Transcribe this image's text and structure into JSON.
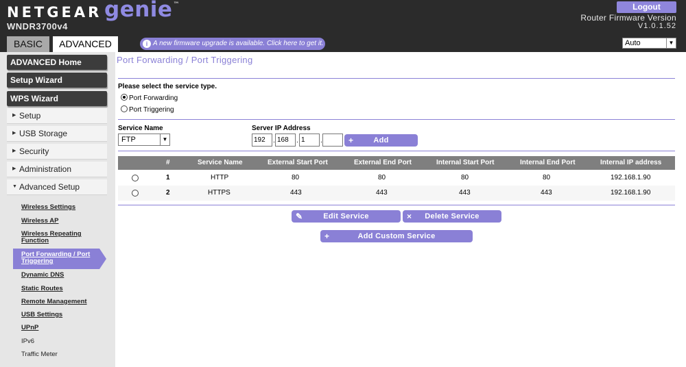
{
  "header": {
    "brand": "NETGEAR",
    "product": "genie",
    "trademark": "™",
    "model": "WNDR3700v4",
    "logout_label": "Logout",
    "firmware_label": "Router Firmware Version",
    "firmware_version": "V1.0.1.52",
    "tabs": [
      {
        "label": "BASIC",
        "active": false
      },
      {
        "label": "ADVANCED",
        "active": true
      }
    ],
    "banner": {
      "icon": "info-icon",
      "text": "A new firmware upgrade is available. Click here to get it."
    },
    "language": {
      "selected": "Auto"
    }
  },
  "sidebar": {
    "main_buttons": [
      "ADVANCED Home",
      "Setup Wizard",
      "WPS Wizard"
    ],
    "sections": [
      {
        "label": "Setup",
        "expanded": false
      },
      {
        "label": "USB Storage",
        "expanded": false
      },
      {
        "label": "Security",
        "expanded": false
      },
      {
        "label": "Administration",
        "expanded": false
      },
      {
        "label": "Advanced Setup",
        "expanded": true
      }
    ],
    "advanced_setup_items": [
      "Wireless Settings",
      "Wireless AP",
      "Wireless Repeating Function",
      "Port Forwarding / Port Triggering",
      "Dynamic DNS",
      "Static Routes",
      "Remote Management",
      "USB Settings",
      "UPnP",
      "IPv6",
      "Traffic Meter"
    ],
    "active_item_index": 3
  },
  "main": {
    "title": "Port Forwarding / Port Triggering",
    "service_type_prompt": "Please select the service type.",
    "service_types": [
      {
        "label": "Port Forwarding",
        "selected": true
      },
      {
        "label": "Port Triggering",
        "selected": false
      }
    ],
    "service_name": {
      "label": "Service Name",
      "selected": "FTP"
    },
    "server_ip": {
      "label": "Server IP Address",
      "octets": [
        "192",
        "168",
        "1",
        ""
      ]
    },
    "add_button": "Add",
    "table": {
      "columns": [
        "#",
        "Service Name",
        "External Start Port",
        "External End Port",
        "Internal Start Port",
        "Internal End Port",
        "Internal IP address"
      ],
      "rows": [
        [
          "1",
          "HTTP",
          "80",
          "80",
          "80",
          "80",
          "192.168.1.90"
        ],
        [
          "2",
          "HTTPS",
          "443",
          "443",
          "443",
          "443",
          "192.168.1.90"
        ]
      ]
    },
    "edit_button": "Edit Service",
    "delete_button": "Delete Service",
    "add_custom_button": "Add Custom Service"
  },
  "colors": {
    "accent": "#8a80d6",
    "header_bg": "#2b2b2b",
    "sidebar_bg": "#e6e6e6",
    "table_head_bg": "#7f7f7f"
  }
}
